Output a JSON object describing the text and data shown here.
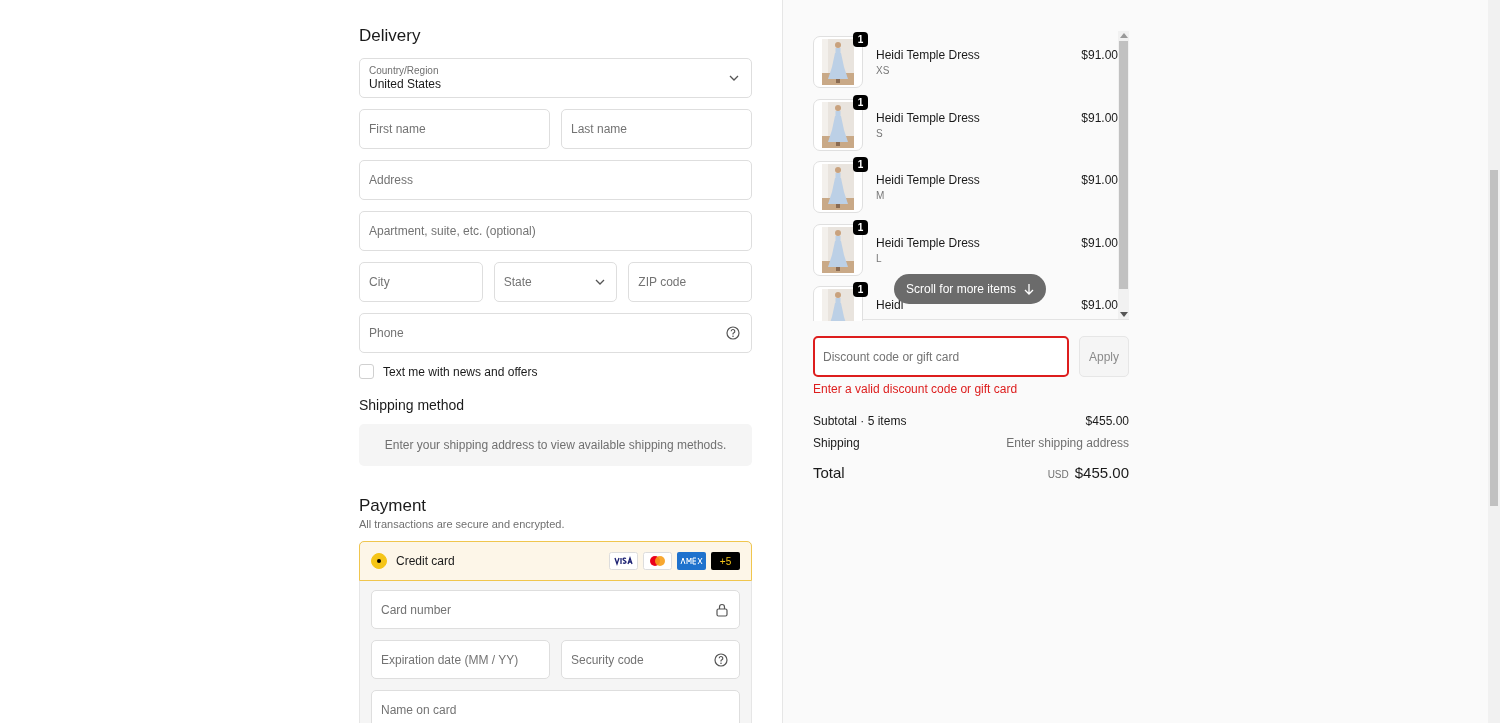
{
  "delivery": {
    "title": "Delivery",
    "country": {
      "label": "Country/Region",
      "value": "United States"
    },
    "rows": [
      [
        {
          "kind": "text",
          "placeholder": "First name"
        },
        {
          "kind": "text",
          "placeholder": "Last name"
        }
      ],
      [
        {
          "kind": "text",
          "placeholder": "Address"
        }
      ],
      [
        {
          "kind": "text",
          "placeholder": "Apartment, suite, etc. (optional)"
        }
      ],
      [
        {
          "kind": "text",
          "placeholder": "City"
        },
        {
          "kind": "select",
          "placeholder": "State"
        },
        {
          "kind": "text",
          "placeholder": "ZIP code"
        }
      ],
      [
        {
          "kind": "help",
          "placeholder": "Phone"
        }
      ]
    ],
    "sms_opt_in": {
      "label": "Text me with news and offers",
      "checked": false
    }
  },
  "shipping": {
    "title": "Shipping method",
    "message": "Enter your shipping address to view available shipping methods."
  },
  "payment": {
    "title": "Payment",
    "subtitle": "All transactions are secure and encrypted.",
    "method": {
      "label": "Credit card",
      "selected": true,
      "more_cards": "+5"
    },
    "rows": [
      [
        {
          "kind": "lock",
          "placeholder": "Card number"
        }
      ],
      [
        {
          "kind": "text",
          "placeholder": "Expiration date (MM / YY)"
        },
        {
          "kind": "help",
          "placeholder": "Security code"
        }
      ],
      [
        {
          "kind": "text",
          "placeholder": "Name on card"
        }
      ]
    ]
  },
  "cart": {
    "items": [
      {
        "name": "Heidi Temple Dress",
        "size": "XS",
        "price": "$91.00",
        "quantity": "1"
      },
      {
        "name": "Heidi Temple Dress",
        "size": "S",
        "price": "$91.00",
        "quantity": "1"
      },
      {
        "name": "Heidi Temple Dress",
        "size": "M",
        "price": "$91.00",
        "quantity": "1"
      },
      {
        "name": "Heidi Temple Dress",
        "size": "L",
        "price": "$91.00",
        "quantity": "1"
      },
      {
        "name": "Heidi",
        "price": "$91.00",
        "quantity": "1"
      }
    ],
    "scroll_hint": "Scroll for more items"
  },
  "discount": {
    "placeholder": "Discount code or gift card",
    "button": "Apply",
    "error": "Enter a valid discount code or gift card"
  },
  "summary": {
    "subtotal_label": "Subtotal · 5 items",
    "subtotal": "$455.00",
    "shipping_label": "Shipping",
    "shipping": "Enter shipping address",
    "total_label": "Total",
    "currency": "USD",
    "total": "$455.00"
  }
}
